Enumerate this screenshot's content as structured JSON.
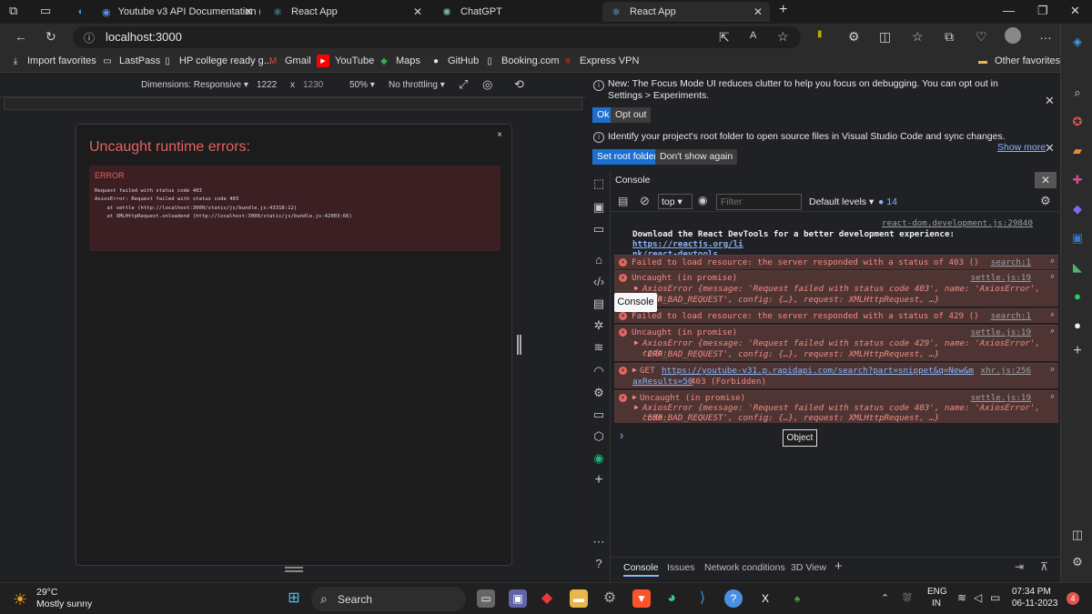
{
  "tabs": [
    {
      "label": "Youtube v3 API Documentation (",
      "icon": "youtube-doc-icon"
    },
    {
      "label": "React App",
      "icon": "react-icon"
    },
    {
      "label": "ChatGPT",
      "icon": "chatgpt-icon"
    },
    {
      "label": "React App",
      "icon": "react-icon",
      "active": true
    }
  ],
  "address": {
    "url": "localhost:3000"
  },
  "favorites": [
    "Import favorites",
    "LastPass",
    "HP college ready g...",
    "Gmail",
    "YouTube",
    "Maps",
    "GitHub",
    "Booking.com",
    "Express VPN",
    "Other favorites"
  ],
  "device_toolbar": {
    "dimensions": "Dimensions: Responsive",
    "width": "1222",
    "times": "x",
    "height": "1230",
    "zoom": "50%",
    "throttle": "No throttling"
  },
  "error_overlay": {
    "title": "Uncaught runtime errors:",
    "close": "×",
    "label": "ERROR",
    "lines": "Request failed with status code 403\nAxiosError: Request failed with status code 403\n    at settle (http://localhost:3000/static/js/bundle.js:43318:12)\n    at XMLHttpRequest.onloadend (http://localhost:3000/static/js/bundle.js:42003:66)"
  },
  "devtools": {
    "notice1": "New: The Focus Mode UI reduces clutter to help you focus on debugging. You can opt out in Settings > Experiments.",
    "ok": "Ok",
    "opt_out": "Opt out",
    "notice2": "Identify your project's root folder to open source files in Visual Studio Code and sync changes.",
    "show_more": "Show more",
    "set_root": "Set root folder",
    "dont_show": "Don't show again",
    "panel_title": "Console",
    "context": "top",
    "filter_placeholder": "Filter",
    "levels": "Default levels",
    "issue_count": "14",
    "tooltip": "Console",
    "object_tip": "Object",
    "bottom_tabs": [
      "Console",
      "Issues",
      "Network conditions",
      "3D View"
    ]
  },
  "console": {
    "devtools_src": "react-dom.development.js:29840",
    "devtools_msg": "Download the React DevTools for a better development experience: ",
    "devtools_link1": "https://reactjs.org/li",
    "devtools_link2": "nk/react-devtools",
    "rows": [
      {
        "msg": "Failed to load resource: the server responded with a status of 403 ()",
        "src": "search:1"
      },
      {
        "msg": "Uncaught (in promise)",
        "src": "settle.js:19",
        "detail1": "AxiosError {message: 'Request failed with status code 403', name: 'AxiosError', code:",
        "detail2": "'ERR_BAD_REQUEST', config: {…}, request: XMLHttpRequest, …}"
      },
      {
        "msg": "Failed to load resource: the server responded with a status of 429 ()",
        "src": "search:1"
      },
      {
        "msg": "Uncaught (in promise)",
        "src": "settle.js:19",
        "detail1": "AxiosError {message: 'Request failed with status code 429', name: 'AxiosError', code:",
        "detail2": "'ERR_BAD_REQUEST', config: {…}, request: XMLHttpRequest, …}"
      },
      {
        "msg": "GET ",
        "link": "https://youtube-v31.p.rapidapi.com/search?part=snippet&q=New&m",
        "link2": "axResults=50",
        "tail": " 403 (Forbidden)",
        "src": "xhr.js:256"
      },
      {
        "msg": "Uncaught (in promise)",
        "src": "settle.js:19",
        "detail1": "AxiosError {message: 'Request failed with status code 403', name: 'AxiosError', code:",
        "detail2": "'ERR_BAD_REQUEST', config: {…}, request: XMLHttpRequest, …}"
      }
    ],
    "prompt": "›"
  },
  "taskbar": {
    "weather_temp": "29°C",
    "weather_desc": "Mostly sunny",
    "search": "Search",
    "lang1": "ENG",
    "lang2": "IN",
    "time": "07:34 PM",
    "date": "06-11-2023",
    "notif": "4"
  }
}
